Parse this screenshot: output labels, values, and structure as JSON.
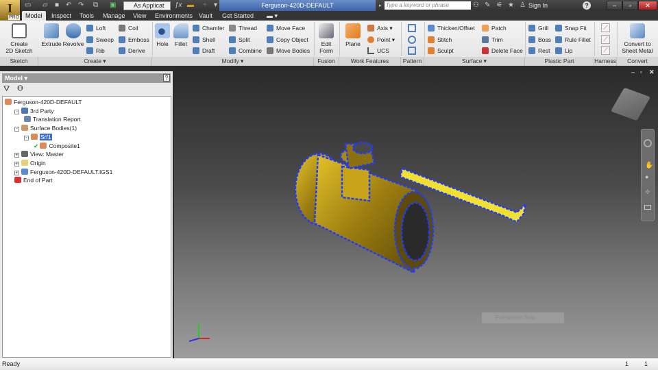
{
  "app": {
    "logo_letter": "I",
    "logo_badge": "PRO",
    "workspace": "As Applicat",
    "document_title": "Ferguson-420D-DEFAULT",
    "search_placeholder": "Type a keyword or phrase",
    "sign_in": "Sign In",
    "help": "?"
  },
  "tabs": [
    {
      "label": "Model",
      "active": true
    },
    {
      "label": "Inspect"
    },
    {
      "label": "Tools"
    },
    {
      "label": "Manage"
    },
    {
      "label": "View"
    },
    {
      "label": "Environments"
    },
    {
      "label": "Vault"
    },
    {
      "label": "Get Started"
    }
  ],
  "ribbon": {
    "sketch": {
      "label": "Sketch",
      "create_2d": "Create\n2D Sketch"
    },
    "create": {
      "label": "Create ▾",
      "extrude": "Extrude",
      "revolve": "Revolve",
      "loft": "Loft",
      "sweep": "Sweep",
      "rib": "Rib",
      "coil": "Coil",
      "emboss": "Emboss",
      "derive": "Derive"
    },
    "modify": {
      "label": "Modify ▾",
      "hole": "Hole",
      "fillet": "Fillet",
      "chamfer": "Chamfer",
      "shell": "Shell",
      "draft": "Draft",
      "thread": "Thread",
      "split": "Split",
      "combine": "Combine",
      "move_face": "Move Face",
      "copy_object": "Copy Object",
      "move_bodies": "Move Bodies"
    },
    "fusion": {
      "label": "Fusion",
      "edit_form": "Edit\nForm"
    },
    "work_features": {
      "label": "Work Features",
      "plane": "Plane",
      "axis": "Axis",
      "point": "Point",
      "ucs": "UCS"
    },
    "pattern": {
      "label": "Pattern"
    },
    "surface": {
      "label": "Surface ▾",
      "thicken": "Thicken/Offset",
      "stitch": "Stitch",
      "sculpt": "Sculpt",
      "patch": "Patch",
      "trim": "Trim",
      "delete_face": "Delete Face"
    },
    "plastic": {
      "label": "Plastic Part",
      "grill": "Grill",
      "boss": "Boss",
      "rest": "Rest",
      "snap_fit": "Snap Fit",
      "rule_fillet": "Rule Fillet",
      "lip": "Lip"
    },
    "harness": {
      "label": "Harness"
    },
    "convert": {
      "label": "Convert",
      "sheet_metal": "Convert to\nSheet Metal"
    }
  },
  "browser": {
    "title": "Model ▾",
    "help": "?",
    "tree": [
      {
        "label": "Ferguson-420D-DEFAULT",
        "depth": 0,
        "icon": "part",
        "color": "#d98b5a"
      },
      {
        "label": "3rd Party",
        "depth": 1,
        "icon": "third-party",
        "color": "#4a78b8",
        "toggle": "-"
      },
      {
        "label": "Translation Report",
        "depth": 2,
        "icon": "report",
        "color": "#6a86b0"
      },
      {
        "label": "Surface Bodies(1)",
        "depth": 1,
        "icon": "surface-bodies",
        "color": "#c99a6a",
        "toggle": "-"
      },
      {
        "label": "Srf1",
        "depth": 2,
        "icon": "surface",
        "color": "#d98b5a",
        "toggle": "-",
        "selected": true
      },
      {
        "label": "Composite1",
        "depth": 3,
        "icon": "composite",
        "color": "#d98b5a",
        "check": true
      },
      {
        "label": "View: Master",
        "depth": 1,
        "icon": "view",
        "color": "#666",
        "toggle": "+"
      },
      {
        "label": "Origin",
        "depth": 1,
        "icon": "folder",
        "color": "#e8cf7a",
        "toggle": "+"
      },
      {
        "label": "Ferguson-420D-DEFAULT.IGS1",
        "depth": 1,
        "icon": "igs",
        "color": "#5a8ad0",
        "toggle": "+"
      },
      {
        "label": "End of Part",
        "depth": 1,
        "icon": "end-of-part",
        "color": "#d83030"
      }
    ]
  },
  "viewport": {
    "snip_tooltip": "Full-screen Snip",
    "colors": {
      "body": "#c9a418",
      "edge": "#1e3cff"
    }
  },
  "status": {
    "text": "Ready",
    "count1": "1",
    "count2": "1"
  }
}
